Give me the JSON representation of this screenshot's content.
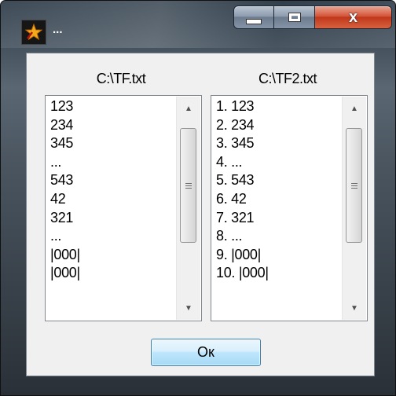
{
  "window": {
    "title": "...",
    "icon": "star-app-icon",
    "close_glyph": "x"
  },
  "left_panel": {
    "label": "C:\\TF.txt",
    "items": [
      "123",
      "234",
      "345",
      "...",
      "543",
      "42",
      "321",
      "...",
      "|000|",
      "|000|"
    ]
  },
  "right_panel": {
    "label": "C:\\TF2.txt",
    "items": [
      "1. 123",
      "2. 234",
      "3. 345",
      "4. ...",
      "5. 543",
      "6. 42",
      "7. 321",
      "8. ...",
      "9. |000|",
      "10. |000|"
    ]
  },
  "ok_button": {
    "label": "Oк"
  },
  "colors": {
    "title_text": "#ffffff",
    "close_button": "#c8422a",
    "ok_border": "#3c7fb1"
  }
}
